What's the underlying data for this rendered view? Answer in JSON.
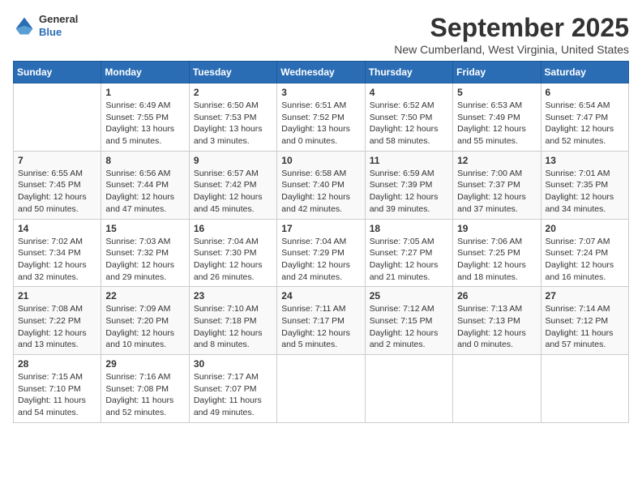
{
  "logo": {
    "general": "General",
    "blue": "Blue"
  },
  "title": "September 2025",
  "location": "New Cumberland, West Virginia, United States",
  "days_of_week": [
    "Sunday",
    "Monday",
    "Tuesday",
    "Wednesday",
    "Thursday",
    "Friday",
    "Saturday"
  ],
  "weeks": [
    [
      {
        "day": "",
        "content": ""
      },
      {
        "day": "1",
        "content": "Sunrise: 6:49 AM\nSunset: 7:55 PM\nDaylight: 13 hours\nand 5 minutes."
      },
      {
        "day": "2",
        "content": "Sunrise: 6:50 AM\nSunset: 7:53 PM\nDaylight: 13 hours\nand 3 minutes."
      },
      {
        "day": "3",
        "content": "Sunrise: 6:51 AM\nSunset: 7:52 PM\nDaylight: 13 hours\nand 0 minutes."
      },
      {
        "day": "4",
        "content": "Sunrise: 6:52 AM\nSunset: 7:50 PM\nDaylight: 12 hours\nand 58 minutes."
      },
      {
        "day": "5",
        "content": "Sunrise: 6:53 AM\nSunset: 7:49 PM\nDaylight: 12 hours\nand 55 minutes."
      },
      {
        "day": "6",
        "content": "Sunrise: 6:54 AM\nSunset: 7:47 PM\nDaylight: 12 hours\nand 52 minutes."
      }
    ],
    [
      {
        "day": "7",
        "content": "Sunrise: 6:55 AM\nSunset: 7:45 PM\nDaylight: 12 hours\nand 50 minutes."
      },
      {
        "day": "8",
        "content": "Sunrise: 6:56 AM\nSunset: 7:44 PM\nDaylight: 12 hours\nand 47 minutes."
      },
      {
        "day": "9",
        "content": "Sunrise: 6:57 AM\nSunset: 7:42 PM\nDaylight: 12 hours\nand 45 minutes."
      },
      {
        "day": "10",
        "content": "Sunrise: 6:58 AM\nSunset: 7:40 PM\nDaylight: 12 hours\nand 42 minutes."
      },
      {
        "day": "11",
        "content": "Sunrise: 6:59 AM\nSunset: 7:39 PM\nDaylight: 12 hours\nand 39 minutes."
      },
      {
        "day": "12",
        "content": "Sunrise: 7:00 AM\nSunset: 7:37 PM\nDaylight: 12 hours\nand 37 minutes."
      },
      {
        "day": "13",
        "content": "Sunrise: 7:01 AM\nSunset: 7:35 PM\nDaylight: 12 hours\nand 34 minutes."
      }
    ],
    [
      {
        "day": "14",
        "content": "Sunrise: 7:02 AM\nSunset: 7:34 PM\nDaylight: 12 hours\nand 32 minutes."
      },
      {
        "day": "15",
        "content": "Sunrise: 7:03 AM\nSunset: 7:32 PM\nDaylight: 12 hours\nand 29 minutes."
      },
      {
        "day": "16",
        "content": "Sunrise: 7:04 AM\nSunset: 7:30 PM\nDaylight: 12 hours\nand 26 minutes."
      },
      {
        "day": "17",
        "content": "Sunrise: 7:04 AM\nSunset: 7:29 PM\nDaylight: 12 hours\nand 24 minutes."
      },
      {
        "day": "18",
        "content": "Sunrise: 7:05 AM\nSunset: 7:27 PM\nDaylight: 12 hours\nand 21 minutes."
      },
      {
        "day": "19",
        "content": "Sunrise: 7:06 AM\nSunset: 7:25 PM\nDaylight: 12 hours\nand 18 minutes."
      },
      {
        "day": "20",
        "content": "Sunrise: 7:07 AM\nSunset: 7:24 PM\nDaylight: 12 hours\nand 16 minutes."
      }
    ],
    [
      {
        "day": "21",
        "content": "Sunrise: 7:08 AM\nSunset: 7:22 PM\nDaylight: 12 hours\nand 13 minutes."
      },
      {
        "day": "22",
        "content": "Sunrise: 7:09 AM\nSunset: 7:20 PM\nDaylight: 12 hours\nand 10 minutes."
      },
      {
        "day": "23",
        "content": "Sunrise: 7:10 AM\nSunset: 7:18 PM\nDaylight: 12 hours\nand 8 minutes."
      },
      {
        "day": "24",
        "content": "Sunrise: 7:11 AM\nSunset: 7:17 PM\nDaylight: 12 hours\nand 5 minutes."
      },
      {
        "day": "25",
        "content": "Sunrise: 7:12 AM\nSunset: 7:15 PM\nDaylight: 12 hours\nand 2 minutes."
      },
      {
        "day": "26",
        "content": "Sunrise: 7:13 AM\nSunset: 7:13 PM\nDaylight: 12 hours\nand 0 minutes."
      },
      {
        "day": "27",
        "content": "Sunrise: 7:14 AM\nSunset: 7:12 PM\nDaylight: 11 hours\nand 57 minutes."
      }
    ],
    [
      {
        "day": "28",
        "content": "Sunrise: 7:15 AM\nSunset: 7:10 PM\nDaylight: 11 hours\nand 54 minutes."
      },
      {
        "day": "29",
        "content": "Sunrise: 7:16 AM\nSunset: 7:08 PM\nDaylight: 11 hours\nand 52 minutes."
      },
      {
        "day": "30",
        "content": "Sunrise: 7:17 AM\nSunset: 7:07 PM\nDaylight: 11 hours\nand 49 minutes."
      },
      {
        "day": "",
        "content": ""
      },
      {
        "day": "",
        "content": ""
      },
      {
        "day": "",
        "content": ""
      },
      {
        "day": "",
        "content": ""
      }
    ]
  ]
}
